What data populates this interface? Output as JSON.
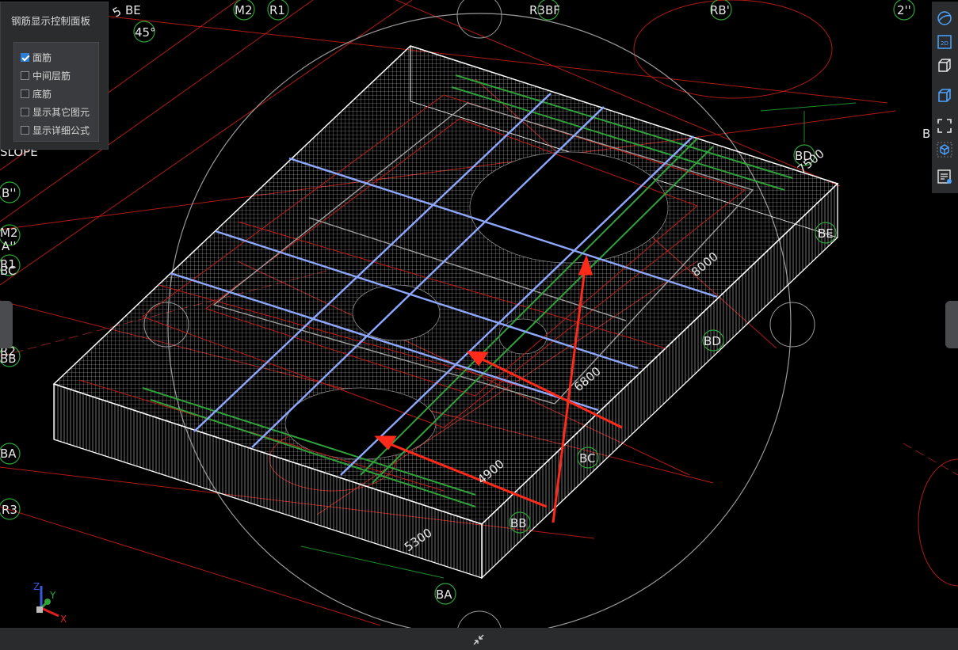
{
  "panel": {
    "title": "钢筋显示控制面板",
    "options": [
      {
        "label": "面筋",
        "checked": true
      },
      {
        "label": "中间层筋",
        "checked": false
      },
      {
        "label": "底筋",
        "checked": false
      },
      {
        "label": "显示其它图元",
        "checked": false
      },
      {
        "label": "显示详细公式",
        "checked": false
      }
    ]
  },
  "toolbar": {
    "buttons": [
      "orbit-icon",
      "2d-view-icon",
      "3d-box-icon",
      "3d-box-active-icon",
      "zoom-extents-icon",
      "rebar-3d-icon",
      "properties-icon"
    ],
    "labels": {
      "two_d": "2D"
    }
  },
  "labels": {
    "top_left_axes": "5",
    "be_top_left": "BE",
    "angle": "45°",
    "m2_top": "M2",
    "r1_top": "R1",
    "r3_bf_top": "R3BF",
    "rb_top": "RB'",
    "two_top": "2''",
    "b_right": "B",
    "slope": "SLOPE",
    "b_dbl": "B''",
    "m2_left": "M2",
    "a_dbl": "A''",
    "r1_left": "R1",
    "bc_left": "BC",
    "r2_left": "R2",
    "bb_left": "BB",
    "ba_left": "BA",
    "r3_left": "R3",
    "bd_top": "BD",
    "be_right": "BE",
    "bd_mid": "BD",
    "bc_mid": "BC",
    "bb_bottom": "BB",
    "ba_bottom": "BA",
    "dim_7500": "7500",
    "dim_8000": "8000",
    "dim_6800": "6800",
    "dim_4900": "4900",
    "dim_5300": "5300"
  },
  "axis_gizmo": {
    "z": "Z",
    "y": "Y",
    "x": "X"
  },
  "colors": {
    "rebar_grid": "#c8c8c8",
    "slab_edge": "#ffffff",
    "blue_beam": "#8fa8ff",
    "green_beam": "#2fa33a",
    "axis_line": "#c0201a",
    "arrow": "#ff2a1a",
    "panel_bg": "#2b2c2e",
    "checkbox_on": "#2d7fd3"
  }
}
